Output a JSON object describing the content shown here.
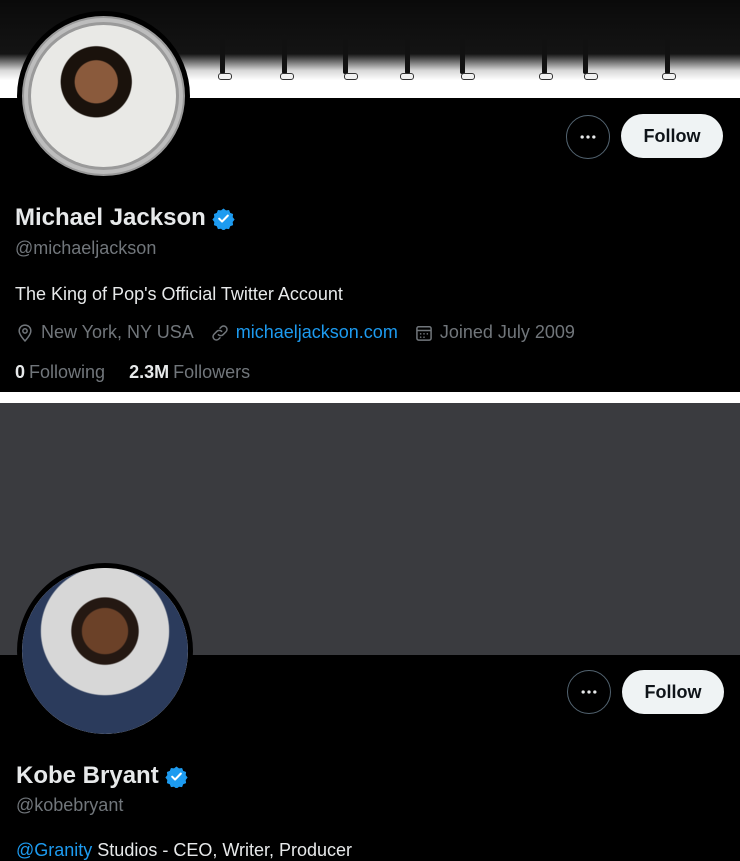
{
  "profiles": [
    {
      "display_name": "Michael Jackson",
      "handle": "@michaeljackson",
      "bio": "The King of Pop's Official Twitter Account",
      "location": "New York, NY USA",
      "website": "michaeljackson.com",
      "joined": "Joined July 2009",
      "following_count": "0",
      "following_label": "Following",
      "followers_count": "2.3M",
      "followers_label": "Followers",
      "follow_label": "Follow"
    },
    {
      "display_name": "Kobe Bryant",
      "handle": "@kobebryant",
      "bio_mention": "@Granity",
      "bio_rest": " Studios - CEO, Writer, Producer",
      "follow_label": "Follow"
    }
  ],
  "colors": {
    "background": "#000000",
    "text_primary": "#e7e9ea",
    "text_secondary": "#71767b",
    "accent": "#1d9bf0",
    "button_bg": "#eff3f4",
    "banner_kobe": "#3a3b3f"
  },
  "icons": {
    "more": "more-horizontal-icon",
    "verified": "verified-badge-icon",
    "location": "location-pin-icon",
    "link": "link-icon",
    "calendar": "calendar-icon"
  }
}
